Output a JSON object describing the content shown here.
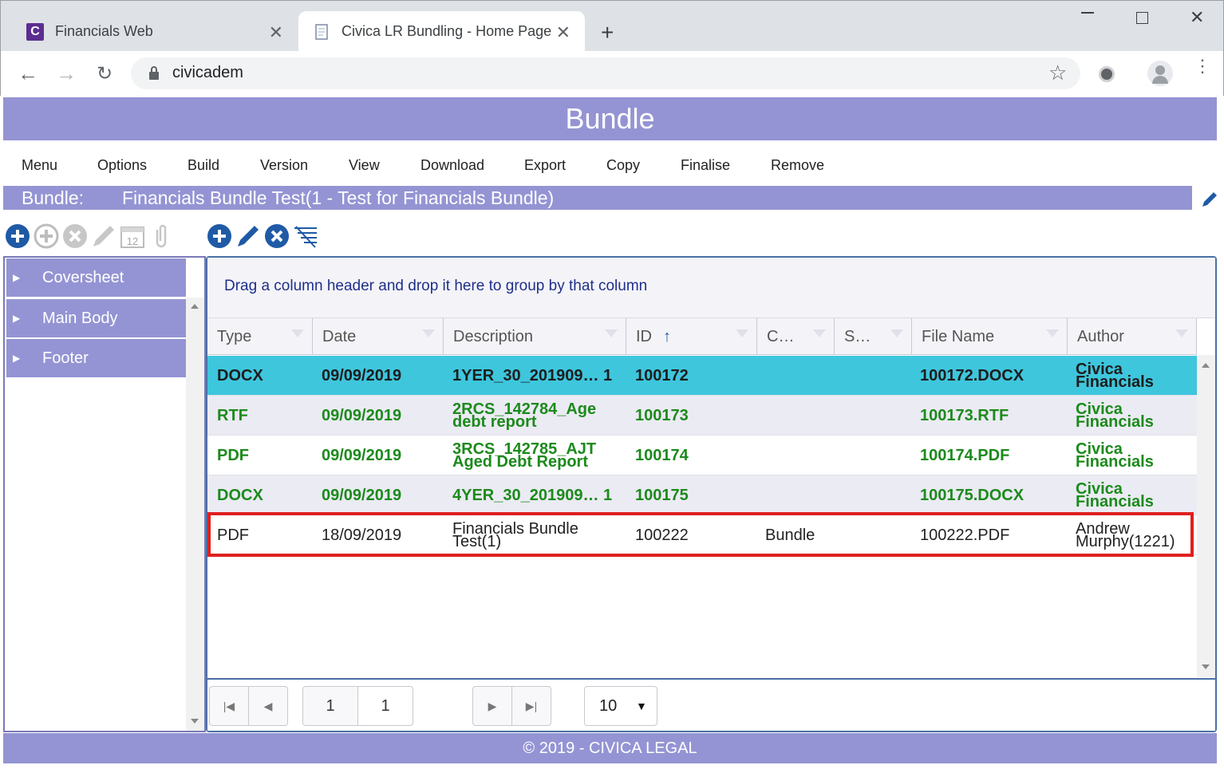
{
  "browser": {
    "tabs": [
      {
        "title": "Financials Web",
        "favicon_letter": "C"
      },
      {
        "title": "Civica LR Bundling - Home Page"
      }
    ],
    "address": "civicadem"
  },
  "app": {
    "title": "Bundle",
    "menu": [
      "Menu",
      "Options",
      "Build",
      "Version",
      "View",
      "Download",
      "Export",
      "Copy",
      "Finalise",
      "Remove"
    ],
    "bundle_label": "Bundle:",
    "bundle_name": "Financials Bundle Test(1 - Test for Financials Bundle)",
    "sections": [
      "Coversheet",
      "Main Body",
      "Footer"
    ],
    "group_hint": "Drag a column header and drop it here to group by that column",
    "columns": [
      "Type",
      "Date",
      "Description",
      "ID",
      "C…",
      "S…",
      "File Name",
      "Author"
    ],
    "rows": [
      {
        "type": "DOCX",
        "date": "09/09/2019",
        "desc": "1YER_30_201909… 1",
        "id": "100172",
        "c": "",
        "s": "",
        "file": "100172.DOCX",
        "author": "Civica Financials"
      },
      {
        "type": "RTF",
        "date": "09/09/2019",
        "desc": "2RCS_142784_Age debt report",
        "id": "100173",
        "c": "",
        "s": "",
        "file": "100173.RTF",
        "author": "Civica Financials"
      },
      {
        "type": "PDF",
        "date": "09/09/2019",
        "desc": "3RCS_142785_AJT Aged Debt Report",
        "id": "100174",
        "c": "",
        "s": "",
        "file": "100174.PDF",
        "author": "Civica Financials"
      },
      {
        "type": "DOCX",
        "date": "09/09/2019",
        "desc": "4YER_30_201909… 1",
        "id": "100175",
        "c": "",
        "s": "",
        "file": "100175.DOCX",
        "author": "Civica Financials"
      },
      {
        "type": "PDF",
        "date": "18/09/2019",
        "desc": "Financials Bundle Test(1)",
        "id": "100222",
        "c": "Bundle",
        "s": "",
        "file": "100222.PDF",
        "author": "Andrew Murphy(1221)"
      }
    ],
    "pager": {
      "page": "1",
      "total_pages": "1",
      "page_size": "10"
    },
    "footer": "© 2019 - CIVICA LEGAL",
    "colors": {
      "header_purple": "#9494d4",
      "selected_row": "#3ec6dd",
      "green_text": "#1c8a1c",
      "highlight_red": "#e02020",
      "icon_blue": "#1f5aa6"
    }
  }
}
